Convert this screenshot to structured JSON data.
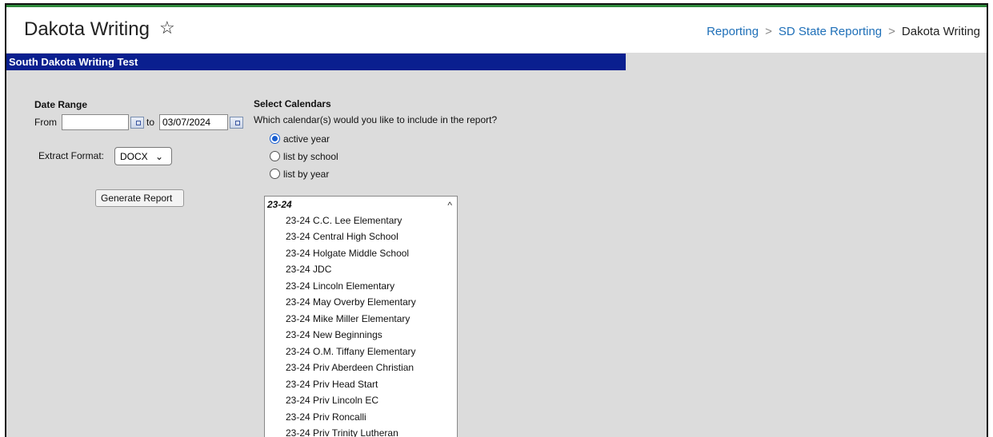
{
  "header": {
    "title": "Dakota Writing",
    "star_glyph": "☆",
    "breadcrumb": {
      "items": [
        "Reporting",
        "SD State Reporting",
        "Dakota Writing"
      ],
      "separator": ">"
    }
  },
  "banner": {
    "text": "South Dakota Writing Test"
  },
  "date_range": {
    "heading": "Date Range",
    "from_label": "From",
    "from_value": "",
    "to_label": "to",
    "to_value": "03/07/2024"
  },
  "extract": {
    "label": "Extract Format:",
    "value": "DOCX",
    "arrow": "⌄"
  },
  "generate_button": "Generate Report",
  "calendars": {
    "heading": "Select Calendars",
    "question": "Which calendar(s) would you like to include in the report?",
    "options": [
      "active year",
      "list by school",
      "list by year"
    ],
    "selected": "active year",
    "group_label": "23-24",
    "scroll_up_glyph": "^",
    "items": [
      "23-24 C.C. Lee Elementary",
      "23-24 Central High School",
      "23-24 Holgate Middle School",
      "23-24 JDC",
      "23-24 Lincoln Elementary",
      "23-24 May Overby Elementary",
      "23-24 Mike Miller Elementary",
      "23-24 New Beginnings",
      "23-24 O.M. Tiffany Elementary",
      "23-24 Priv Aberdeen Christian",
      "23-24 Priv Head Start",
      "23-24 Priv Lincoln EC",
      "23-24 Priv Roncalli",
      "23-24 Priv Trinity Lutheran"
    ]
  },
  "colors": {
    "banner": "#0a1f8f",
    "link": "#1e6fb8",
    "radio": "#1a5fd0"
  }
}
